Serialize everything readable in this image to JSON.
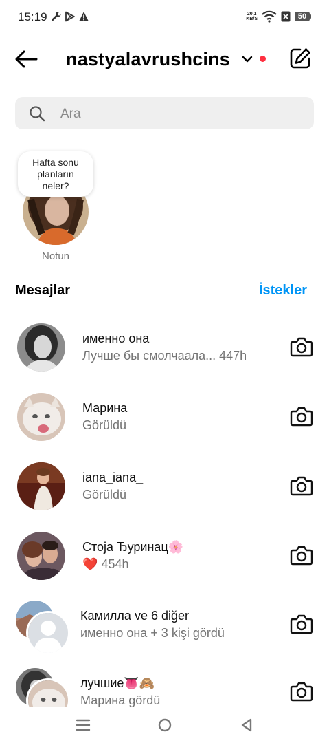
{
  "status_bar": {
    "time": "15:19",
    "netspeed_value": "20,1",
    "netspeed_unit": "KB/S",
    "battery": "50"
  },
  "header": {
    "username": "nastyalavrushcins",
    "has_unread_dot": true
  },
  "search": {
    "placeholder": "Ara"
  },
  "note": {
    "text_lines": [
      "Hafta sonu",
      "planların",
      "neler?"
    ],
    "label": "Notun"
  },
  "section": {
    "title": "Mesajlar",
    "requests_label": "İstekler"
  },
  "threads": [
    {
      "name": "именно она",
      "subtitle": "Лучше бы смолчаала... 447h"
    },
    {
      "name": "Марина",
      "subtitle": "Görüldü"
    },
    {
      "name": "iana_iana_",
      "subtitle": "Görüldü"
    },
    {
      "name": "Стоја Ђуринац🌸",
      "reaction": "❤️",
      "subtitle": "454h"
    },
    {
      "name": "Камилла ve 6 diğer",
      "subtitle": "именно она + 3 kişi gördü"
    },
    {
      "name": "лучшие👅🙈",
      "subtitle": "Марина gördü"
    }
  ],
  "colors": {
    "accent": "#0095f6",
    "unread_dot": "#ff3040",
    "muted_text": "#737373"
  }
}
